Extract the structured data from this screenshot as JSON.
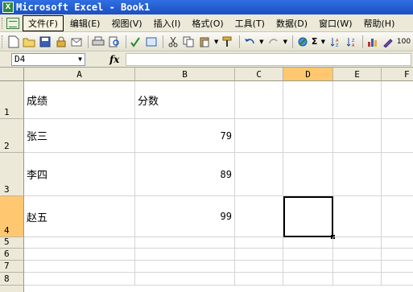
{
  "window": {
    "title": "Microsoft Excel - Book1",
    "app_icon": "excel-icon"
  },
  "menu": {
    "items": [
      "文件(F)",
      "编辑(E)",
      "视图(V)",
      "插入(I)",
      "格式(O)",
      "工具(T)",
      "数据(D)",
      "窗口(W)",
      "帮助(H)"
    ],
    "active_index": 0
  },
  "toolbar": {
    "sum_label": "Σ",
    "zoom_label": "100"
  },
  "formula_bar": {
    "name_box": "D4",
    "fx_label": "fx",
    "formula": ""
  },
  "columns": [
    "A",
    "B",
    "C",
    "D",
    "E",
    "F"
  ],
  "rows": [
    "1",
    "2",
    "3",
    "4",
    "5",
    "6",
    "7",
    "8"
  ],
  "selected": {
    "column": "D",
    "row": "4"
  },
  "cells": {
    "A1": "成绩",
    "B1": "分数",
    "A2": "张三",
    "B2": "79",
    "A3": "李四",
    "B3": "89",
    "A4": "赵五",
    "B4": "99"
  },
  "colors": {
    "selection_header": "#ffc870",
    "title_bar": "#2f6fe3"
  }
}
